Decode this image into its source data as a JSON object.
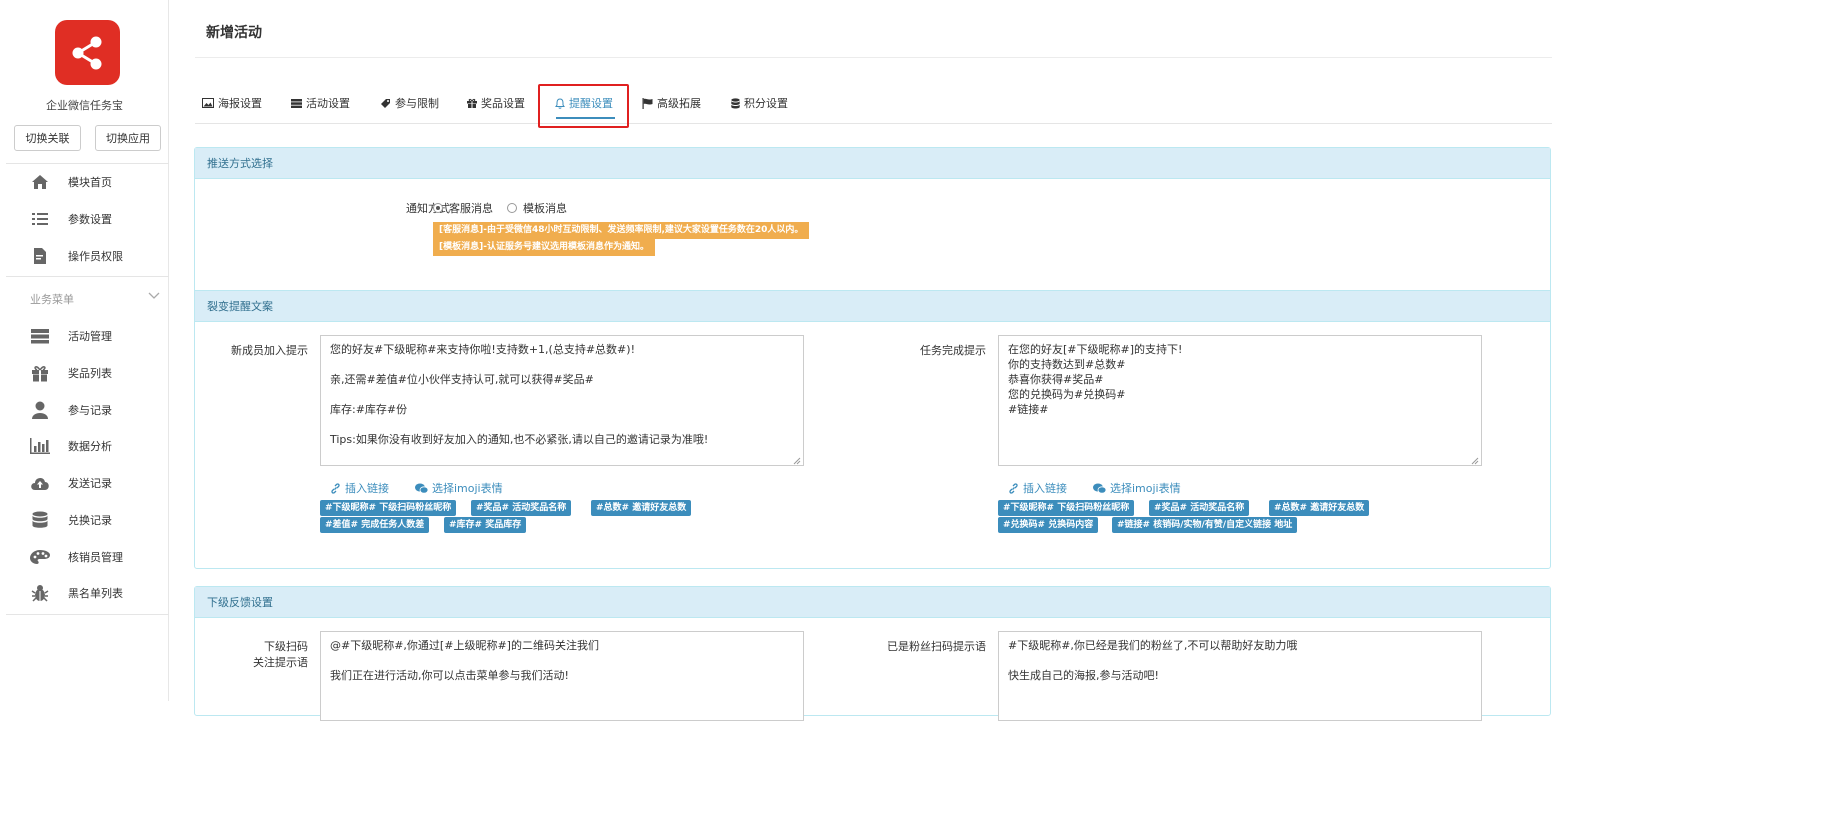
{
  "sidebar": {
    "app_name": "企业微信任务宝",
    "switch_link": "切换关联",
    "switch_app": "切换应用",
    "top_items": [
      {
        "label": "模块首页",
        "icon": "home-icon"
      },
      {
        "label": "参数设置",
        "icon": "list-icon"
      },
      {
        "label": "操作员权限",
        "icon": "file-edit-icon"
      }
    ],
    "section_title": "业务菜单",
    "business_items": [
      {
        "label": "活动管理",
        "icon": "server-icon"
      },
      {
        "label": "奖品列表",
        "icon": "gift-icon"
      },
      {
        "label": "参与记录",
        "icon": "user-icon"
      },
      {
        "label": "数据分析",
        "icon": "bar-chart-icon"
      },
      {
        "label": "发送记录",
        "icon": "cloud-upload-icon"
      },
      {
        "label": "兑换记录",
        "icon": "database-icon"
      },
      {
        "label": "核销员管理",
        "icon": "palette-icon"
      },
      {
        "label": "黑名单列表",
        "icon": "bug-icon"
      }
    ]
  },
  "page": {
    "title": "新增活动"
  },
  "tabs": [
    {
      "label": "海报设置",
      "icon": "image-icon"
    },
    {
      "label": "活动设置",
      "icon": "server-icon"
    },
    {
      "label": "参与限制",
      "icon": "tag-icon"
    },
    {
      "label": "奖品设置",
      "icon": "gift-icon"
    },
    {
      "label": "提醒设置",
      "icon": "bell-icon",
      "active": true
    },
    {
      "label": "高级拓展",
      "icon": "flag-icon"
    },
    {
      "label": "积分设置",
      "icon": "database-icon"
    }
  ],
  "push": {
    "panel_title": "推送方式选择",
    "notify_label": "通知方式",
    "option_kefu": "客服消息",
    "option_template": "模板消息",
    "selected": "客服消息",
    "note_kefu": "[客服消息]-由于受微信48小时互动限制、发送频率限制,建议大家设置任务数在20人以内。",
    "note_template": "[模板消息]-认证服务号建议选用模板消息作为通知。"
  },
  "fission": {
    "section_title": "裂变提醒文案",
    "join_label": "新成员加入提示",
    "join_text": "您的好友#下级昵称#来支持你啦!支持数+1,(总支持#总数#)!\n\n亲,还需#差值#位小伙伴支持认可,就可以获得#奖品#\n\n库存:#库存#份\n\nTips:如果你没有收到好友加入的通知,也不必紧张,请以自己的邀请记录为准哦!",
    "complete_label": "任务完成提示",
    "complete_text": "在您的好友[#下级昵称#]的支持下!\n你的支持数达到#总数#\n恭喜你获得#奖品#\n您的兑换码为#兑换码#\n#链接#",
    "insert_link": "插入链接",
    "choose_emoji": "选择imoji表情",
    "join_tags": [
      "#下级昵称# 下级扫码粉丝昵称",
      "#奖品# 活动奖品名称",
      "#总数# 邀请好友总数",
      "#差值# 完成任务人数差",
      "#库存# 奖品库存"
    ],
    "complete_tags": [
      "#下级昵称# 下级扫码粉丝昵称",
      "#奖品# 活动奖品名称",
      "#总数# 邀请好友总数",
      "#兑换码# 兑换码内容",
      "#链接# 核销码/实物/有赞/自定义链接 地址"
    ]
  },
  "feedback": {
    "panel_title": "下级反馈设置",
    "scan_label_1": "下级扫码",
    "scan_label_2": "关注提示语",
    "scan_text": "@#下级昵称#,你通过[#上级昵称#]的二维码关注我们\n\n我们正在进行活动,你可以点击菜单参与我们活动!",
    "fan_label": "已是粉丝扫码提示语",
    "fan_text": "#下级昵称#,你已经是我们的粉丝了,不可以帮助好友助力哦\n\n快生成自己的海报,参与活动吧!"
  },
  "colors": {
    "brand": "#e02e24",
    "accent": "#3c8dbc",
    "warning": "#f0ad4e",
    "panel_head": "#d9edf7",
    "highlight_frame": "#e02020"
  }
}
